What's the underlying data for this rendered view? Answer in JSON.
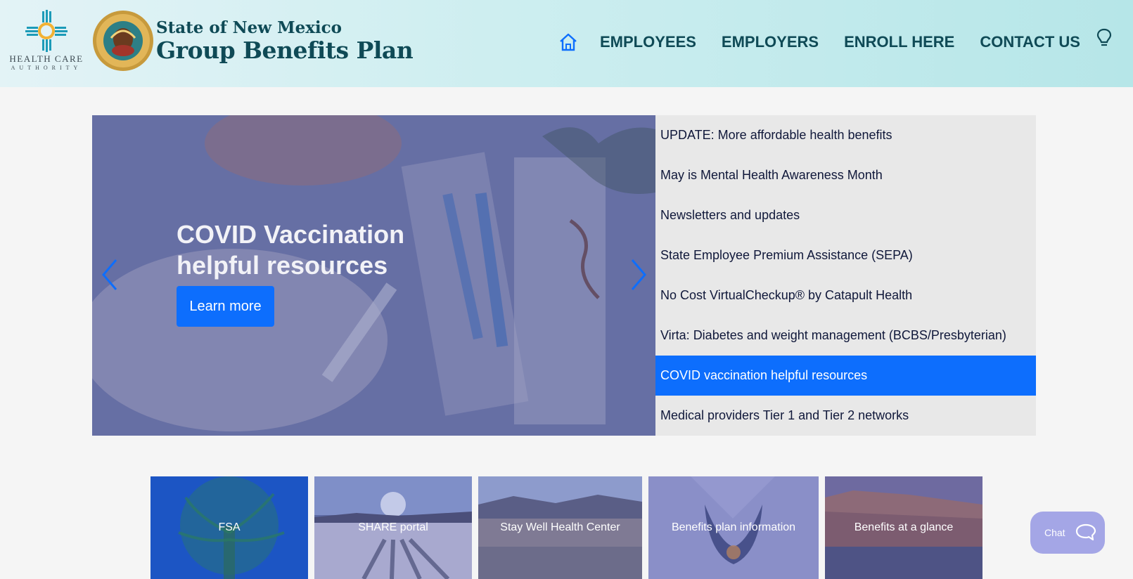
{
  "header": {
    "hca_line1": "HEALTH CARE",
    "hca_line2": "AUTHORITY",
    "title_line1": "State of New Mexico",
    "title_line2": "Group Benefits Plan",
    "seal_icon": "great-seal-of-new-mexico",
    "nav": [
      {
        "label": "EMPLOYEES"
      },
      {
        "label": "EMPLOYERS"
      },
      {
        "label": "ENROLL HERE"
      },
      {
        "label": "CONTACT US"
      }
    ]
  },
  "carousel": {
    "slide_title": "COVID Vaccination helpful resources",
    "button_label": "Learn more",
    "items": [
      {
        "label": "UPDATE: More affordable health benefits"
      },
      {
        "label": "May is Mental Health Awareness Month"
      },
      {
        "label": "Newsletters and updates"
      },
      {
        "label": "State Employee Premium Assistance (SEPA)"
      },
      {
        "label": "No Cost VirtualCheckup® by Catapult Health"
      },
      {
        "label": "Virta: Diabetes and weight management (BCBS/Presbyterian)"
      },
      {
        "label": "COVID vaccination helpful resources",
        "active": true
      },
      {
        "label": "Medical providers Tier 1 and Tier 2 networks"
      }
    ]
  },
  "tiles": [
    {
      "label": "FSA"
    },
    {
      "label": "SHARE portal"
    },
    {
      "label": "Stay Well Health Center"
    },
    {
      "label": "Benefits plan information"
    },
    {
      "label": "Benefits at a glance"
    }
  ],
  "chat": {
    "label": "Chat"
  },
  "colors": {
    "accent": "#0d6efd",
    "brand_text": "#0f4a56",
    "header_bg": "#cdeef0",
    "chat_bg": "#a4a6e6"
  }
}
